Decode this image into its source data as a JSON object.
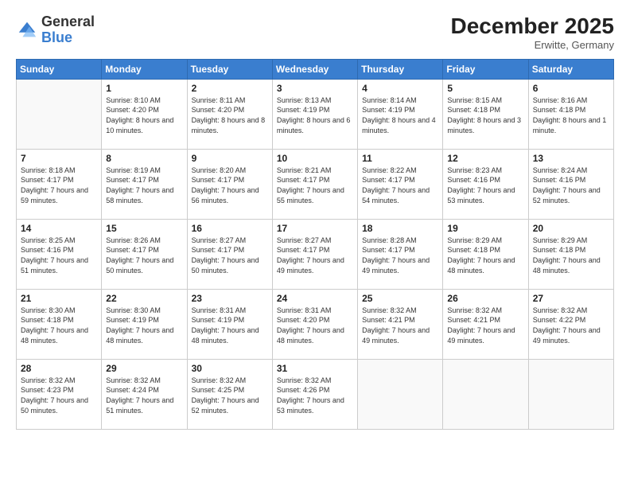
{
  "logo": {
    "general": "General",
    "blue": "Blue"
  },
  "title": "December 2025",
  "subtitle": "Erwitte, Germany",
  "header_days": [
    "Sunday",
    "Monday",
    "Tuesday",
    "Wednesday",
    "Thursday",
    "Friday",
    "Saturday"
  ],
  "weeks": [
    [
      {
        "day": "",
        "sunrise": "",
        "sunset": "",
        "daylight": "",
        "empty": true
      },
      {
        "day": "1",
        "sunrise": "Sunrise: 8:10 AM",
        "sunset": "Sunset: 4:20 PM",
        "daylight": "Daylight: 8 hours and 10 minutes."
      },
      {
        "day": "2",
        "sunrise": "Sunrise: 8:11 AM",
        "sunset": "Sunset: 4:20 PM",
        "daylight": "Daylight: 8 hours and 8 minutes."
      },
      {
        "day": "3",
        "sunrise": "Sunrise: 8:13 AM",
        "sunset": "Sunset: 4:19 PM",
        "daylight": "Daylight: 8 hours and 6 minutes."
      },
      {
        "day": "4",
        "sunrise": "Sunrise: 8:14 AM",
        "sunset": "Sunset: 4:19 PM",
        "daylight": "Daylight: 8 hours and 4 minutes."
      },
      {
        "day": "5",
        "sunrise": "Sunrise: 8:15 AM",
        "sunset": "Sunset: 4:18 PM",
        "daylight": "Daylight: 8 hours and 3 minutes."
      },
      {
        "day": "6",
        "sunrise": "Sunrise: 8:16 AM",
        "sunset": "Sunset: 4:18 PM",
        "daylight": "Daylight: 8 hours and 1 minute."
      }
    ],
    [
      {
        "day": "7",
        "sunrise": "Sunrise: 8:18 AM",
        "sunset": "Sunset: 4:17 PM",
        "daylight": "Daylight: 7 hours and 59 minutes."
      },
      {
        "day": "8",
        "sunrise": "Sunrise: 8:19 AM",
        "sunset": "Sunset: 4:17 PM",
        "daylight": "Daylight: 7 hours and 58 minutes."
      },
      {
        "day": "9",
        "sunrise": "Sunrise: 8:20 AM",
        "sunset": "Sunset: 4:17 PM",
        "daylight": "Daylight: 7 hours and 56 minutes."
      },
      {
        "day": "10",
        "sunrise": "Sunrise: 8:21 AM",
        "sunset": "Sunset: 4:17 PM",
        "daylight": "Daylight: 7 hours and 55 minutes."
      },
      {
        "day": "11",
        "sunrise": "Sunrise: 8:22 AM",
        "sunset": "Sunset: 4:17 PM",
        "daylight": "Daylight: 7 hours and 54 minutes."
      },
      {
        "day": "12",
        "sunrise": "Sunrise: 8:23 AM",
        "sunset": "Sunset: 4:16 PM",
        "daylight": "Daylight: 7 hours and 53 minutes."
      },
      {
        "day": "13",
        "sunrise": "Sunrise: 8:24 AM",
        "sunset": "Sunset: 4:16 PM",
        "daylight": "Daylight: 7 hours and 52 minutes."
      }
    ],
    [
      {
        "day": "14",
        "sunrise": "Sunrise: 8:25 AM",
        "sunset": "Sunset: 4:16 PM",
        "daylight": "Daylight: 7 hours and 51 minutes."
      },
      {
        "day": "15",
        "sunrise": "Sunrise: 8:26 AM",
        "sunset": "Sunset: 4:17 PM",
        "daylight": "Daylight: 7 hours and 50 minutes."
      },
      {
        "day": "16",
        "sunrise": "Sunrise: 8:27 AM",
        "sunset": "Sunset: 4:17 PM",
        "daylight": "Daylight: 7 hours and 50 minutes."
      },
      {
        "day": "17",
        "sunrise": "Sunrise: 8:27 AM",
        "sunset": "Sunset: 4:17 PM",
        "daylight": "Daylight: 7 hours and 49 minutes."
      },
      {
        "day": "18",
        "sunrise": "Sunrise: 8:28 AM",
        "sunset": "Sunset: 4:17 PM",
        "daylight": "Daylight: 7 hours and 49 minutes."
      },
      {
        "day": "19",
        "sunrise": "Sunrise: 8:29 AM",
        "sunset": "Sunset: 4:18 PM",
        "daylight": "Daylight: 7 hours and 48 minutes."
      },
      {
        "day": "20",
        "sunrise": "Sunrise: 8:29 AM",
        "sunset": "Sunset: 4:18 PM",
        "daylight": "Daylight: 7 hours and 48 minutes."
      }
    ],
    [
      {
        "day": "21",
        "sunrise": "Sunrise: 8:30 AM",
        "sunset": "Sunset: 4:18 PM",
        "daylight": "Daylight: 7 hours and 48 minutes."
      },
      {
        "day": "22",
        "sunrise": "Sunrise: 8:30 AM",
        "sunset": "Sunset: 4:19 PM",
        "daylight": "Daylight: 7 hours and 48 minutes."
      },
      {
        "day": "23",
        "sunrise": "Sunrise: 8:31 AM",
        "sunset": "Sunset: 4:19 PM",
        "daylight": "Daylight: 7 hours and 48 minutes."
      },
      {
        "day": "24",
        "sunrise": "Sunrise: 8:31 AM",
        "sunset": "Sunset: 4:20 PM",
        "daylight": "Daylight: 7 hours and 48 minutes."
      },
      {
        "day": "25",
        "sunrise": "Sunrise: 8:32 AM",
        "sunset": "Sunset: 4:21 PM",
        "daylight": "Daylight: 7 hours and 49 minutes."
      },
      {
        "day": "26",
        "sunrise": "Sunrise: 8:32 AM",
        "sunset": "Sunset: 4:21 PM",
        "daylight": "Daylight: 7 hours and 49 minutes."
      },
      {
        "day": "27",
        "sunrise": "Sunrise: 8:32 AM",
        "sunset": "Sunset: 4:22 PM",
        "daylight": "Daylight: 7 hours and 49 minutes."
      }
    ],
    [
      {
        "day": "28",
        "sunrise": "Sunrise: 8:32 AM",
        "sunset": "Sunset: 4:23 PM",
        "daylight": "Daylight: 7 hours and 50 minutes."
      },
      {
        "day": "29",
        "sunrise": "Sunrise: 8:32 AM",
        "sunset": "Sunset: 4:24 PM",
        "daylight": "Daylight: 7 hours and 51 minutes."
      },
      {
        "day": "30",
        "sunrise": "Sunrise: 8:32 AM",
        "sunset": "Sunset: 4:25 PM",
        "daylight": "Daylight: 7 hours and 52 minutes."
      },
      {
        "day": "31",
        "sunrise": "Sunrise: 8:32 AM",
        "sunset": "Sunset: 4:26 PM",
        "daylight": "Daylight: 7 hours and 53 minutes."
      },
      {
        "day": "",
        "sunrise": "",
        "sunset": "",
        "daylight": "",
        "empty": true
      },
      {
        "day": "",
        "sunrise": "",
        "sunset": "",
        "daylight": "",
        "empty": true
      },
      {
        "day": "",
        "sunrise": "",
        "sunset": "",
        "daylight": "",
        "empty": true
      }
    ]
  ]
}
